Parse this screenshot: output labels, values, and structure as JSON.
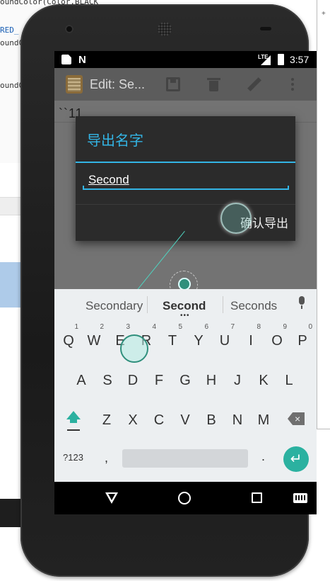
{
  "background": {
    "code_lines": [
      "oundColor(Color.BLACK",
      "RED_",
      "oundCo",
      "oundCo"
    ],
    "right_panel_mark": "+"
  },
  "status_bar": {
    "network_label": "LTE",
    "time": "3:57"
  },
  "app_bar": {
    "title": "Edit: Se...",
    "icons": [
      "notepad-icon",
      "save-icon",
      "delete-icon",
      "edit-icon",
      "more-icon"
    ]
  },
  "editor": {
    "text": "``11"
  },
  "dialog": {
    "title": "导出名字",
    "input_value": "Second",
    "confirm_label": "确认导出"
  },
  "keyboard": {
    "suggestions": [
      "Secondary",
      "Second",
      "Seconds"
    ],
    "suggestion_more": "•••",
    "row1": [
      {
        "key": "Q",
        "num": "1"
      },
      {
        "key": "W",
        "num": "2"
      },
      {
        "key": "E",
        "num": "3"
      },
      {
        "key": "R",
        "num": "4"
      },
      {
        "key": "T",
        "num": "5"
      },
      {
        "key": "Y",
        "num": "6"
      },
      {
        "key": "U",
        "num": "7"
      },
      {
        "key": "I",
        "num": "8"
      },
      {
        "key": "O",
        "num": "9"
      },
      {
        "key": "P",
        "num": "0"
      }
    ],
    "row2": [
      "A",
      "S",
      "D",
      "F",
      "G",
      "H",
      "J",
      "K",
      "L"
    ],
    "row3": [
      "Z",
      "X",
      "C",
      "V",
      "B",
      "N",
      "M"
    ],
    "symbols_label": "?123",
    "comma_label": ",",
    "period_label": ".",
    "enter_label": "↵",
    "backspace_label": "×"
  },
  "colors": {
    "accent": "#33b5e5",
    "keyboard_accent": "#2bb1a0"
  }
}
